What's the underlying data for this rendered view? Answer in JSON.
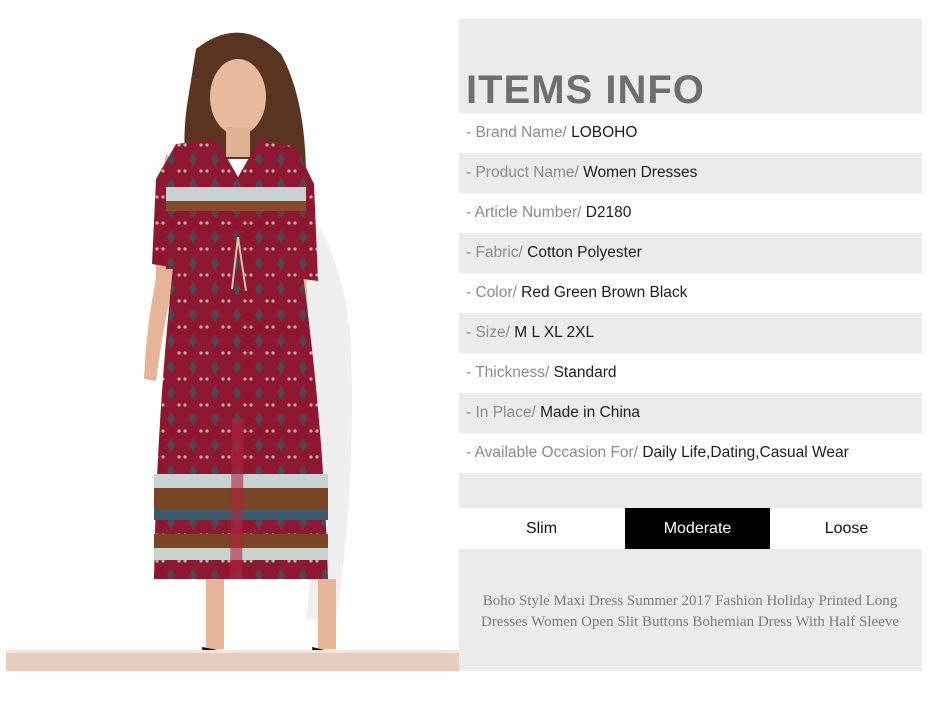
{
  "items_info": {
    "title": "ITEMS INFO",
    "rows": [
      {
        "label": "- Brand Name/ ",
        "value": "LOBOHO"
      },
      {
        "label": "- Product Name/ ",
        "value": "Women Dresses"
      },
      {
        "label": "- Article Number/ ",
        "value": "D2180"
      },
      {
        "label": "- Fabric/ ",
        "value": "Cotton Polyester"
      },
      {
        "label": "- Color/ ",
        "value": "Red Green Brown Black"
      },
      {
        "label": "- Size/ ",
        "value": "M L XL 2XL"
      },
      {
        "label": "- Thickness/ ",
        "value": "Standard"
      },
      {
        "label": "- In Place/ ",
        "value": "Made in China"
      },
      {
        "label": "- Available Occasion For/ ",
        "value": "Daily Life,Dating,Casual Wear"
      }
    ]
  },
  "fit": {
    "options": [
      "Slim",
      "Moderate",
      "Loose"
    ],
    "selected": "Moderate"
  },
  "description": "Boho Style Maxi Dress Summer 2017 Fashion Holiday Printed Long Dresses Women Open Slit Buttons Bohemian Dress With Half Sleeve",
  "colors": {
    "title": "#6f6f70",
    "panel_bg": "#ebebeb",
    "dress": "#8e1732",
    "selected_fit": "#000000"
  }
}
